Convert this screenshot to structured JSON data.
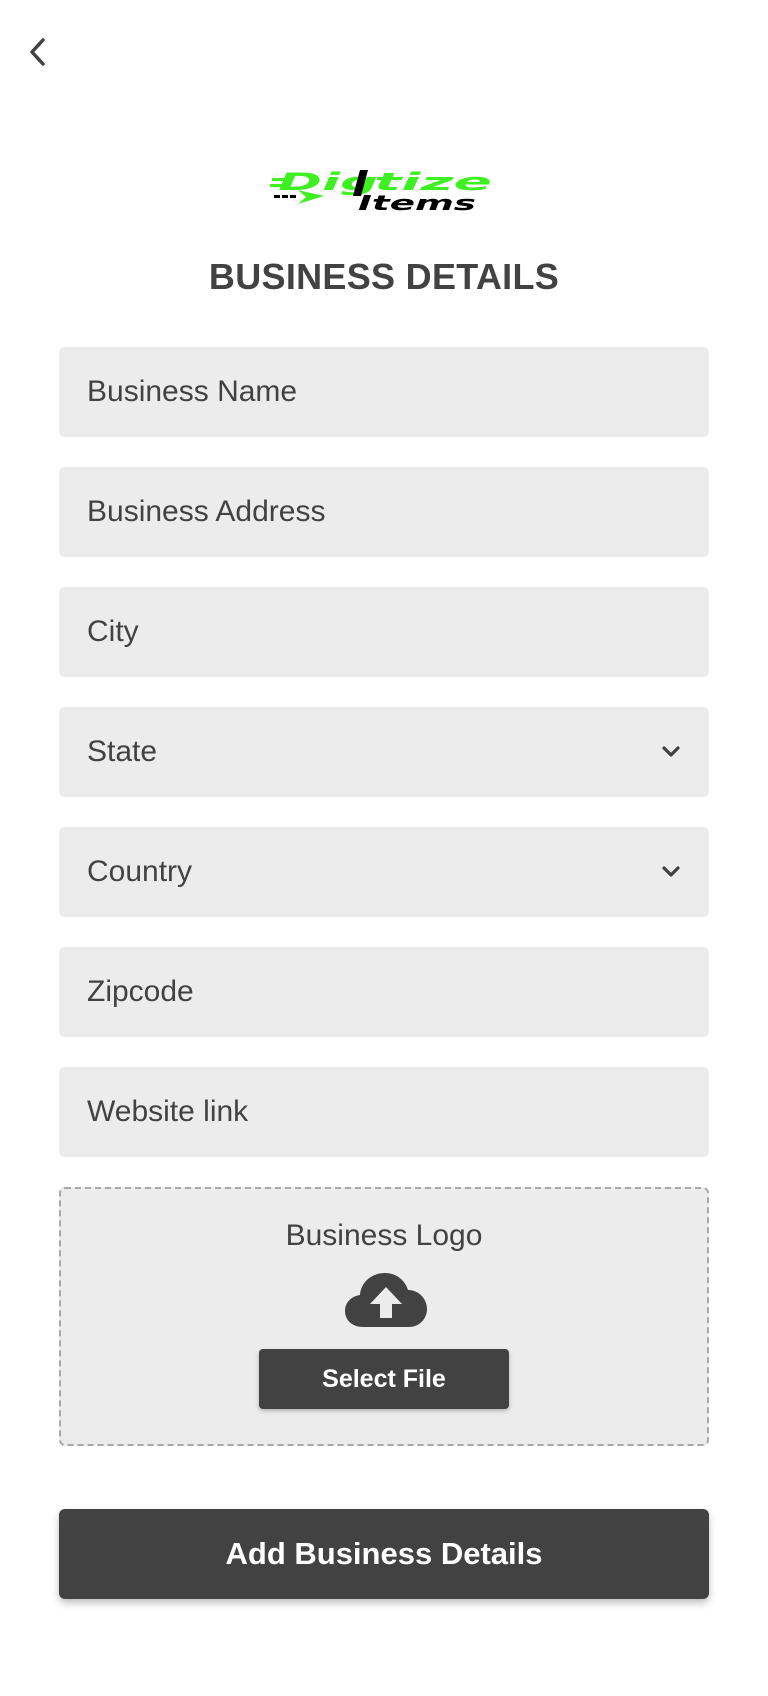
{
  "header": {
    "back_icon": "chevron-left-icon"
  },
  "logo": {
    "text_top": "Digitize",
    "text_bottom": "Items",
    "colors": {
      "green": "#3ef021",
      "black": "#000000"
    }
  },
  "page": {
    "title": "BUSINESS DETAILS"
  },
  "form": {
    "business_name": {
      "placeholder": "Business Name"
    },
    "business_address": {
      "placeholder": "Business Address"
    },
    "city": {
      "placeholder": "City"
    },
    "state": {
      "selected": "State",
      "icon": "chevron-down-icon"
    },
    "country": {
      "selected": "Country",
      "icon": "chevron-down-icon"
    },
    "zipcode": {
      "placeholder": "Zipcode"
    },
    "website": {
      "placeholder": "Website link"
    }
  },
  "upload": {
    "label": "Business Logo",
    "icon": "cloud-upload-icon",
    "button_label": "Select File"
  },
  "submit": {
    "label": "Add Business Details"
  },
  "colors": {
    "field_bg": "#ececec",
    "text": "#424242",
    "button_bg": "#424242",
    "button_text": "#ffffff"
  }
}
